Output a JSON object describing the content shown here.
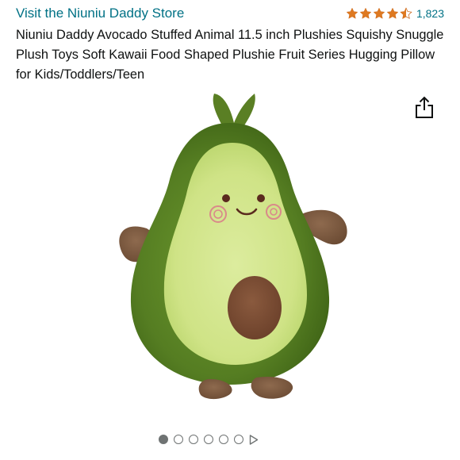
{
  "header": {
    "store_link": "Visit the Niuniu Daddy Store",
    "rating": {
      "stars": 4.5,
      "max_stars": 5,
      "review_count": "1,823",
      "star_color": "#de7921"
    }
  },
  "product": {
    "title": "Niuniu Daddy Avocado Stuffed Animal 11.5 inch Plushies Squishy Snuggle Plush Toys Soft Kawaii Food Shaped Plushie Fruit Series Hugging Pillow for Kids/Toddlers/Teen",
    "image_icon": "avocado-plush-image"
  },
  "actions": {
    "share_icon": "share-icon"
  },
  "carousel": {
    "total_images": 6,
    "active_index": 0,
    "has_video": true,
    "video_icon": "play-icon"
  },
  "colors": {
    "link": "#007185",
    "text": "#0f1111",
    "dot": "#6f7373"
  }
}
